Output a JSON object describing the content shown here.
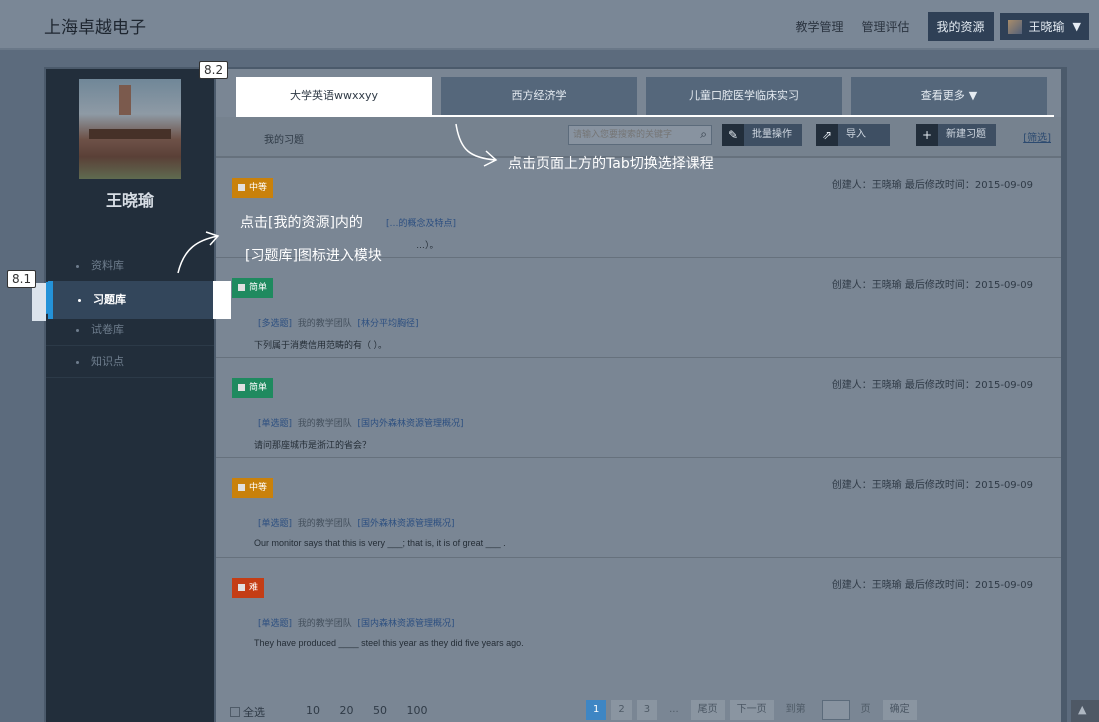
{
  "app": {
    "title": "上海卓越电子"
  },
  "topnav": {
    "links": [
      "教学管理",
      "管理评估"
    ],
    "active": "我的资源",
    "user": "王晓瑜"
  },
  "sidebar": {
    "user_name": "王晓瑜",
    "items": [
      {
        "label": "资料库",
        "active": false
      },
      {
        "label": "习题库",
        "active": true
      },
      {
        "label": "试卷库",
        "active": false
      },
      {
        "label": "知识点",
        "active": false
      }
    ]
  },
  "tabs": [
    {
      "label": "大学英语wwxxyy",
      "active": true
    },
    {
      "label": "西方经济学",
      "active": false
    },
    {
      "label": "儿童口腔医学临床实习",
      "active": false
    },
    {
      "label": "查看更多",
      "active": false
    }
  ],
  "toolbar": {
    "title": "我的习题",
    "search_placeholder": "请输入您要搜索的关键字",
    "batch": "批量操作",
    "import": "导入",
    "new": "新建习题",
    "filter": "[筛选]"
  },
  "questions": [
    {
      "level": "中等",
      "color": "#c9810b",
      "meta": "创建人：王晓瑜  最后修改时间：2015-09-09",
      "type": "",
      "team": "",
      "topic": "[…的概念及特点]",
      "stem": "…）。"
    },
    {
      "level": "简单",
      "color": "#1f8a5f",
      "meta": "创建人：王晓瑜  最后修改时间：2015-09-09",
      "type": "[多选题]",
      "team": "我的教学团队",
      "topic": "[林分平均胸径]",
      "stem": "下列属于消费信用范畴的有（ ）。"
    },
    {
      "level": "简单",
      "color": "#1f8a5f",
      "meta": "创建人：王晓瑜  最后修改时间：2015-09-09",
      "type": "[单选题]",
      "team": "我的教学团队",
      "topic": "[国内外森林资源管理概况]",
      "stem": "请问那座城市是浙江的省会？"
    },
    {
      "level": "中等",
      "color": "#c9810b",
      "meta": "创建人：王晓瑜  最后修改时间：2015-09-09",
      "type": "[单选题]",
      "team": "我的教学团队",
      "topic": "[国外森林资源管理概况]",
      "stem": "Our monitor says that this is very ___; that is, it is of great ___ ."
    },
    {
      "level": "难",
      "color": "#c43d15",
      "meta": "创建人：王晓瑜  最后修改时间：2015-09-09",
      "type": "[单选题]",
      "team": "我的教学团队",
      "topic": "[国内森林资源管理概况]",
      "stem": "They have produced ____ steel this year as they did five years ago."
    }
  ],
  "pager": {
    "select_all": "全选",
    "sizes": [
      "10",
      "20",
      "50",
      "100"
    ],
    "pages": [
      "1",
      "2",
      "3",
      "..."
    ],
    "last": "尾页",
    "next": "下一页",
    "goto": "到第",
    "page_unit": "页",
    "confirm": "确定"
  },
  "tutorial": {
    "step_a": "8.2",
    "step_b": "8.1",
    "hint_tab": "点击页面上方的Tab切换选择课程",
    "hint_menu_1": "点击[我的资源]内的",
    "hint_menu_2": "[习题库]图标进入模块"
  }
}
